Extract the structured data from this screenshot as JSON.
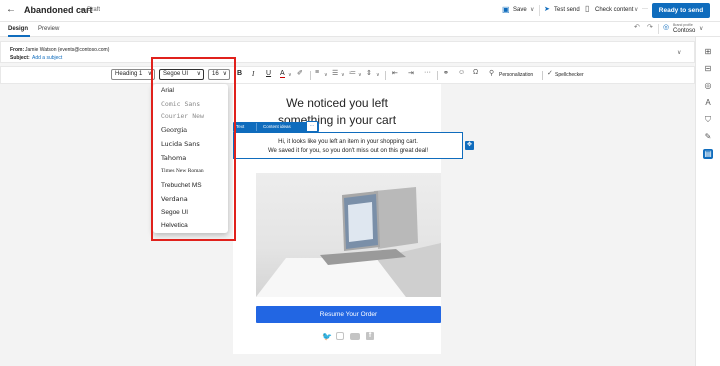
{
  "app": {
    "title": "Abandoned cart",
    "status": "Draft",
    "actions": {
      "save": "Save",
      "test_send": "Test send",
      "check_content": "Check content",
      "more": "···",
      "ready": "Ready to send"
    },
    "brand_small": "Brand profile",
    "brand_name": "Contoso"
  },
  "tabs": [
    "Design",
    "Preview"
  ],
  "header": {
    "from_label": "From:",
    "from_value": "Jamie Watson (events@contoso.com)",
    "subject_label": "Subject:",
    "subject_placeholder": "Add a subject"
  },
  "toolbar": {
    "style_select": "Heading 1",
    "font_select": "Segoe UI",
    "size_select": "16",
    "bold": "B",
    "italic": "I",
    "underline": "U",
    "font_color": "A",
    "personalization": "Personalization",
    "spellchecker": "Spellchecker",
    "more": "···"
  },
  "font_menu": [
    "Arial",
    "Comic Sans",
    "Courier New",
    "Georgia",
    "Lucida Sans",
    "Tahoma",
    "Times New Roman",
    "Trebuchet MS",
    "Verdana",
    "Segoe UI",
    "Helvetica"
  ],
  "email": {
    "heading_line1": "We noticed you left",
    "heading_line2": "something in your cart",
    "block_chip_text": "Text",
    "block_chip_ideas": "Content ideas",
    "block_chip_more": "···",
    "body_line1": "Hi, it looks like you left an item in your shopping cart.",
    "body_line2": "We saved it for you, so you don't miss out on this great deal!",
    "cta": "Resume Your Order"
  },
  "colors": {
    "accent": "#0f6cbd",
    "highlight": "#e0211c"
  },
  "icons": [
    "back-arrow-icon",
    "save-icon",
    "send-icon",
    "check-content-icon",
    "undo-icon",
    "redo-icon",
    "brand-icon",
    "chevron-down-icon",
    "twitter-icon",
    "instagram-icon",
    "youtube-icon",
    "facebook-icon"
  ]
}
